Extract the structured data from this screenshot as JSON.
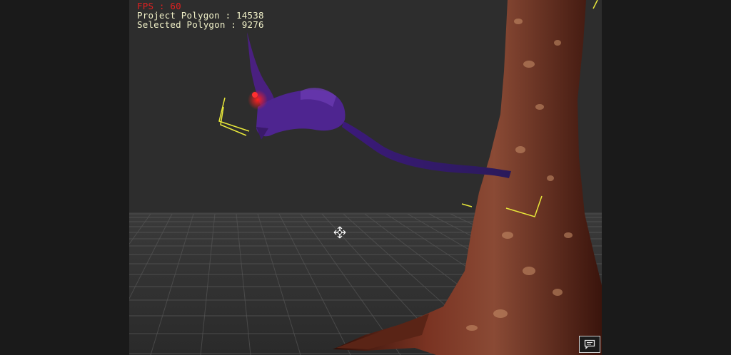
{
  "hud": {
    "fps_label": "FPS : 60",
    "project_polygon_label": "Project Polygon : 14538",
    "selected_polygon_label": "Selected Polygon : 9276"
  },
  "colors": {
    "viewport_bg": "#2d2d2d",
    "grid_line": "#5a5a5a",
    "fps_text": "#e02020",
    "stats_text": "#f0f0c8",
    "selection_bracket": "#e8e83a",
    "creature": "#5a2a9a",
    "tree_bark": "#6a2a1a"
  },
  "icons": {
    "cursor": "move-cursor-icon",
    "chat": "chat-icon"
  }
}
